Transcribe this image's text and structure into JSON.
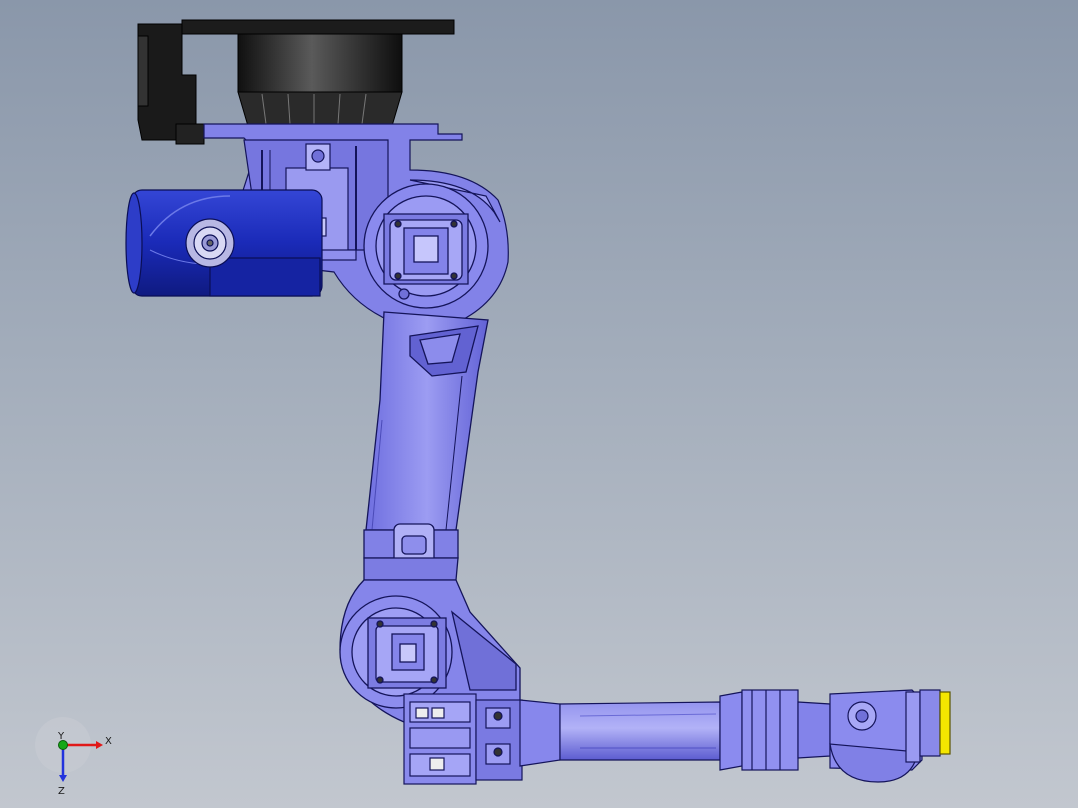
{
  "viewport": {
    "orientation_triad": {
      "x_label": "X",
      "y_label": "Y",
      "z_label": "Z",
      "colors": {
        "x": "#e01818",
        "y": "#16a816",
        "z": "#2233dd"
      }
    },
    "colors": {
      "body": "#8585ea",
      "body_dark": "#5a5ad0",
      "motor_blue": "#1c2fb8",
      "base_black": "#1b1b1b",
      "flange_yellow": "#f4e600",
      "edge": "#14145a"
    }
  }
}
